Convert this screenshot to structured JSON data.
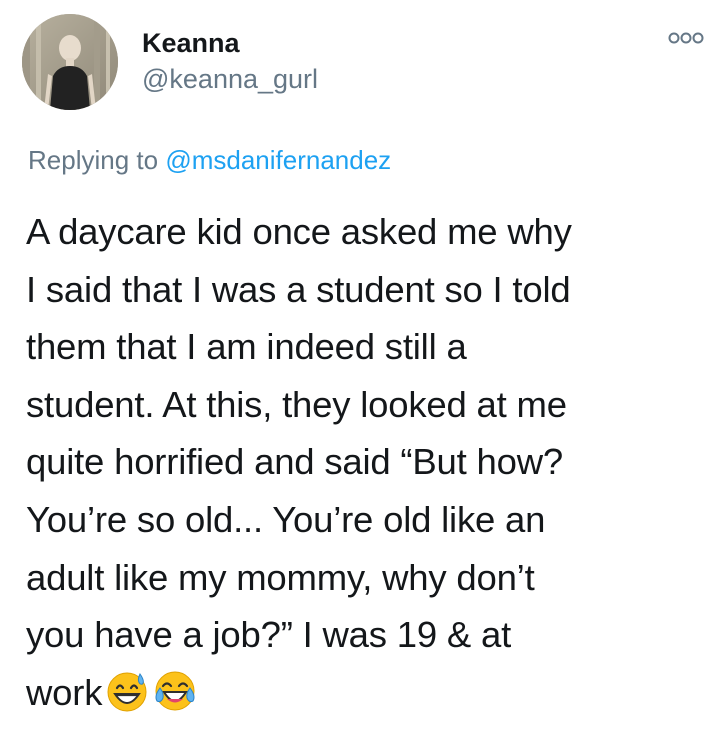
{
  "tweet": {
    "display_name": "Keanna",
    "handle": "@keanna_gurl",
    "more_icon": "more-horizontal-icon",
    "replying_prefix": "Replying to",
    "replying_mention": "@msdanifernandez",
    "body_lines": [
      "A daycare kid once asked me why",
      "I said that I was a student so I told",
      "them that I am indeed still a",
      "student. At this, they looked at me",
      "quite horrified and said “But how?",
      "You’re so old... You’re old like an",
      "adult like my mommy, why don’t",
      "you have a job?” I was 19 & at",
      "work"
    ],
    "emojis": [
      "grinning-face-with-sweat-emoji",
      "face-with-tears-of-joy-emoji"
    ]
  },
  "colors": {
    "text_primary": "#14171a",
    "text_secondary": "#657786",
    "accent_link": "#1da1f2",
    "background": "#ffffff"
  }
}
